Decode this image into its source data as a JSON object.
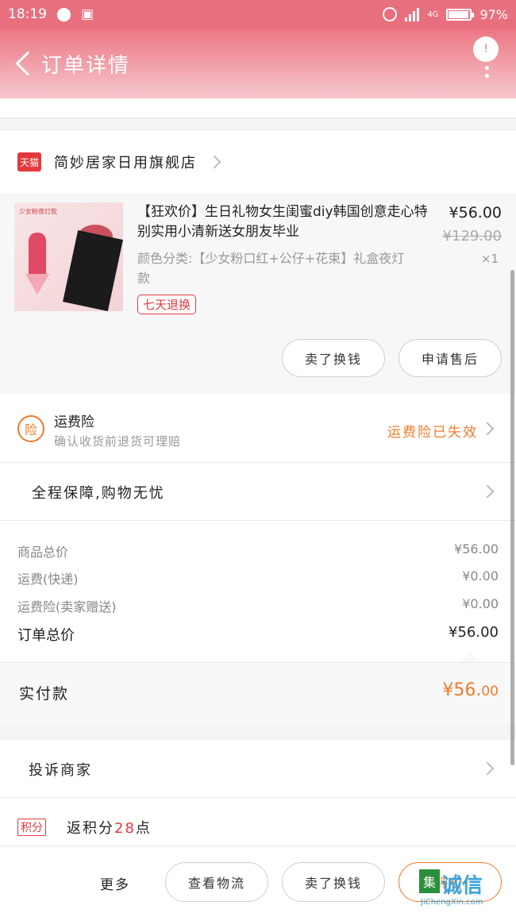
{
  "status_bar": {
    "time": "18:19",
    "network": "4G",
    "battery": "97%"
  },
  "header": {
    "title": "订单详情",
    "badge": "!"
  },
  "store": {
    "badge": "天猫",
    "name": "简妙居家日用旗舰店"
  },
  "product": {
    "image_tag": "少女粉夜灯款",
    "title": "【狂欢价】生日礼物女生闺蜜diy韩国创意走心特别实用小清新送女朋友毕业",
    "price": "¥56.00",
    "original_price": "¥129.00",
    "quantity": "×1",
    "spec": "颜色分类:【少女粉口红+公仔+花束】礼盒夜灯款",
    "tag": "七天退换",
    "buttons": {
      "sell": "卖了换钱",
      "after_sale": "申请售后"
    }
  },
  "insurance": {
    "icon": "险",
    "title": "运费险",
    "subtitle": "确认收货前退货可理赔",
    "status": "运费险已失效"
  },
  "guarantee": {
    "label": "全程保障,购物无忧"
  },
  "summary": {
    "rows": [
      {
        "label": "商品总价",
        "value": "¥56.00"
      },
      {
        "label": "运费(快递)",
        "value": "¥0.00"
      },
      {
        "label": "运费险(卖家赠送)",
        "value": "¥0.00"
      }
    ],
    "total_label": "订单总价",
    "total_value": "¥56.00"
  },
  "payment": {
    "label": "实付款",
    "amount_int": "¥56.",
    "amount_dec": "00"
  },
  "complain": {
    "label": "投诉商家"
  },
  "points": {
    "tag": "积分",
    "prefix": "返积分",
    "value": "28",
    "suffix": "点"
  },
  "bottom_bar": {
    "more": "更多",
    "logistics": "查看物流",
    "sell": "卖了换钱",
    "review": "评价"
  },
  "watermark": {
    "box": "集",
    "text": "诚信",
    "url": "JiChengXin.com"
  },
  "colors": {
    "accent": "#f07a2b",
    "brand_red": "#e4393c",
    "header": "#ec7683"
  }
}
